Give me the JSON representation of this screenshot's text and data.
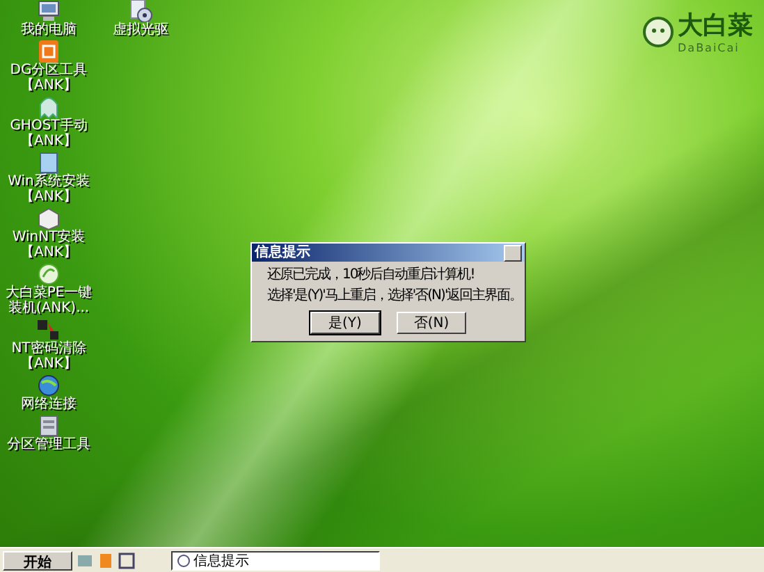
{
  "desktop": {
    "icons": [
      {
        "kind": "computer",
        "lines": [
          "我的电脑"
        ]
      },
      {
        "kind": "disc",
        "lines": [
          "虚拟光驱"
        ]
      },
      {
        "kind": "orange",
        "lines": [
          "DG分区工具",
          "【ANK】"
        ]
      },
      {
        "kind": "ghost",
        "lines": [
          "GHOST手动",
          "【ANK】"
        ]
      },
      {
        "kind": "window",
        "lines": [
          "Win系统安装",
          "【ANK】"
        ]
      },
      {
        "kind": "box",
        "lines": [
          "WinNT安装",
          "【ANK】"
        ]
      },
      {
        "kind": "leaf",
        "lines": [
          "大白菜PE一键",
          "装机(ANK)..."
        ]
      },
      {
        "kind": "nt",
        "lines": [
          "NT密码清除",
          "【ANK】"
        ]
      },
      {
        "kind": "globe",
        "lines": [
          "网络连接"
        ]
      },
      {
        "kind": "disk",
        "lines": [
          "分区管理工具"
        ]
      }
    ]
  },
  "logo": {
    "name": "大白菜",
    "subtitle": "DaBaiCai"
  },
  "dialog": {
    "title": "信息提示",
    "lines": [
      "还原已完成，10秒后自动重启计算机!",
      "选择'是(Y)'马上重启，选择'否(N)'返回主界面。"
    ],
    "buttons": [
      {
        "label": "是(Y)",
        "default": true
      },
      {
        "label": "否(N)",
        "default": false
      }
    ]
  },
  "taskbar": {
    "start": "开始",
    "tasks": [
      {
        "label": "信息提示",
        "selected": true
      }
    ]
  }
}
